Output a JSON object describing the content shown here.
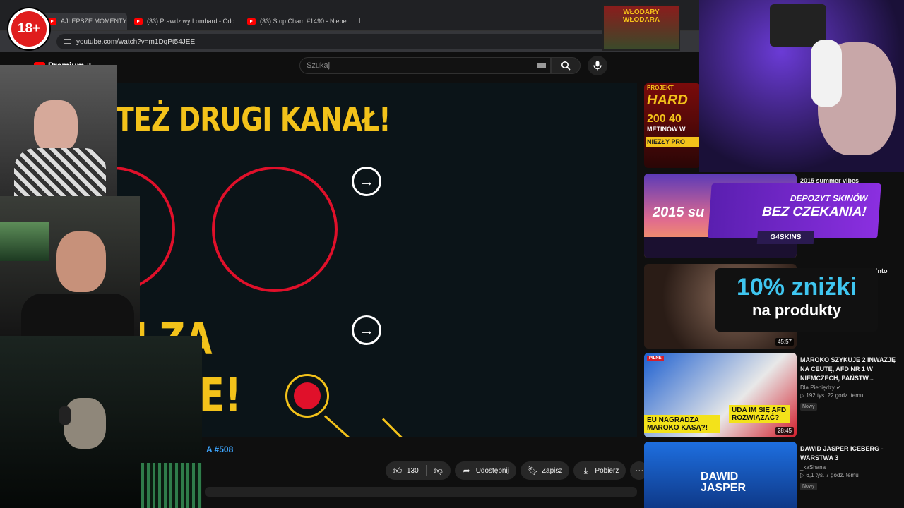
{
  "age_badge": "18+",
  "browser": {
    "tabs": [
      {
        "label": "AJLEPSZE MOMENTY PO",
        "close": "✕"
      },
      {
        "label": "(33) Prawdziwy Lombard - Odc",
        "close": "✕"
      },
      {
        "label": "(33) Stop Cham #1490 - Niebe",
        "close": "✕"
      }
    ],
    "new_tab": "+",
    "url": "youtube.com/watch?v=m1DqPt54JEE"
  },
  "youtube": {
    "logo_text": "Premium",
    "logo_region": "PL",
    "search_placeholder": "Szukaj"
  },
  "video": {
    "headline": "TEŻ DRUGI KANAŁ!",
    "text_za": "KI ZA",
    "text_nie": "NIE!",
    "hashtag": "A #508"
  },
  "actions": {
    "like_count": "130",
    "share": "Udostępnij",
    "save": "Zapisz",
    "download": "Pobierz",
    "more": "⋯"
  },
  "sidebar": {
    "items": [
      {
        "title": "",
        "channel": "",
        "views": "",
        "thumb_text": [
          "PROJEKT",
          "HARD",
          "200 40",
          "METINÓW W",
          "NIEZŁY PRO"
        ]
      },
      {
        "title": "2015 summer vibes",
        "channel": "",
        "views": "",
        "thumb_text": [
          "2015 su"
        ]
      },
      {
        "title": "songs to turn your room into",
        "channel": "",
        "views": "",
        "duration": "45:57"
      },
      {
        "title": "MAROKO SZYKUJE 2 INWAZJĘ NA CEUTĘ, AFD NR 1 W NIEMCZECH, PAŃSTW...",
        "channel": "Dla Pieniędzy",
        "views": "192 tys.  22 godz. temu",
        "badge": "Nowy",
        "duration": "28:45",
        "thumb_text": [
          "PILNE",
          "EU NAGRADZA MAROKO KASĄ?!",
          "UDA IM SIĘ AFD ROZWIĄZAĆ?"
        ]
      },
      {
        "title": "DAWID JASPER ICEBERG - WARSTWA 3",
        "channel": "_kaShana",
        "views": "6,1 tys.  7 godz. temu",
        "badge": "Nowy",
        "thumb_text": [
          "DAWID",
          "JASPER"
        ]
      }
    ]
  },
  "overlays": {
    "stream_banner_title": "WŁODARY WŁODARA",
    "skins_line1": "DEPOZYT SKINÓW",
    "skins_line2": "BEZ CZEKANIA!",
    "skins_brand": "G4SKINS",
    "promo_line1": "10% zniżki",
    "promo_line2": "na produkty"
  },
  "colors": {
    "accent_yellow": "#f3c21a",
    "accent_red": "#e0102a",
    "link_blue": "#3ea6ff",
    "promo_cyan": "#3fc6f0"
  }
}
